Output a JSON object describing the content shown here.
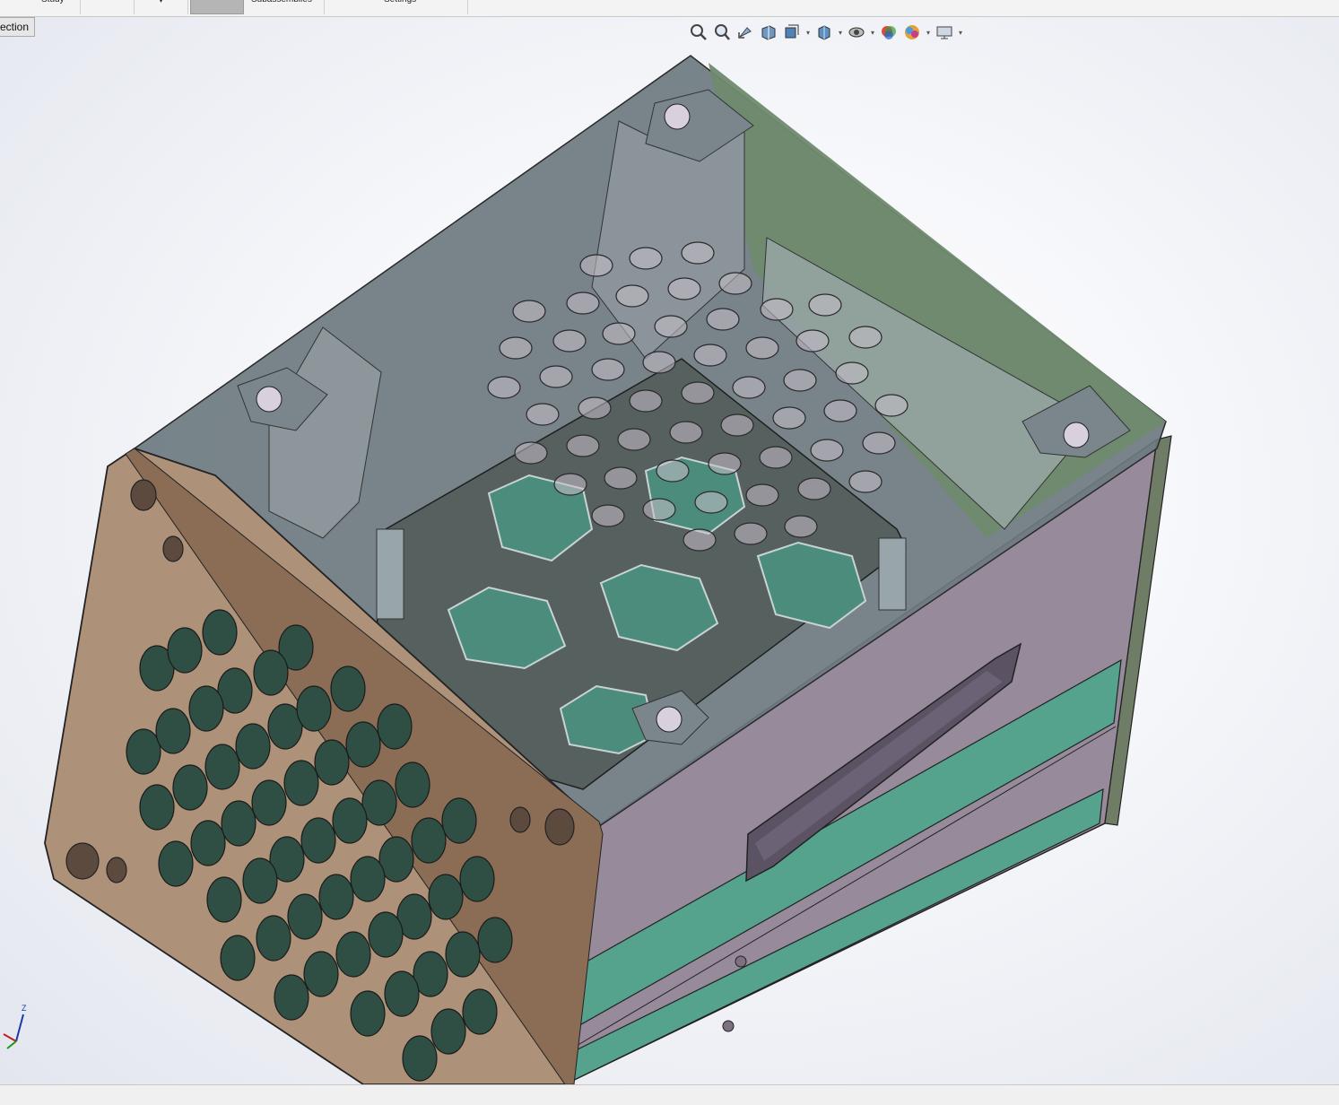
{
  "ribbon": {
    "tabs": [
      {
        "label": "Study"
      },
      {
        "label": ""
      },
      {
        "label": ""
      },
      {
        "label": ""
      },
      {
        "label": "Subassemblies"
      },
      {
        "label": "Settings"
      }
    ]
  },
  "viewport": {
    "section_tab_label": "ection",
    "hud_icons": [
      "zoom-to-fit-icon",
      "zoom-to-area-icon",
      "previous-view-icon",
      "section-view-icon",
      "view-orientation-icon",
      "display-style-icon",
      "hide-show-items-icon",
      "edit-appearance-icon",
      "apply-scene-icon",
      "view-settings-icon"
    ],
    "triad_axis_label": "Z"
  },
  "colors": {
    "front_panel": "#ad9179",
    "side_panel": "#968a9b",
    "stripe": "#55a28d",
    "glass": "#6d7a80",
    "glass_green": "#6f8a6e",
    "shelf": "#56615f",
    "hex_cell": "#4c8c7d"
  }
}
